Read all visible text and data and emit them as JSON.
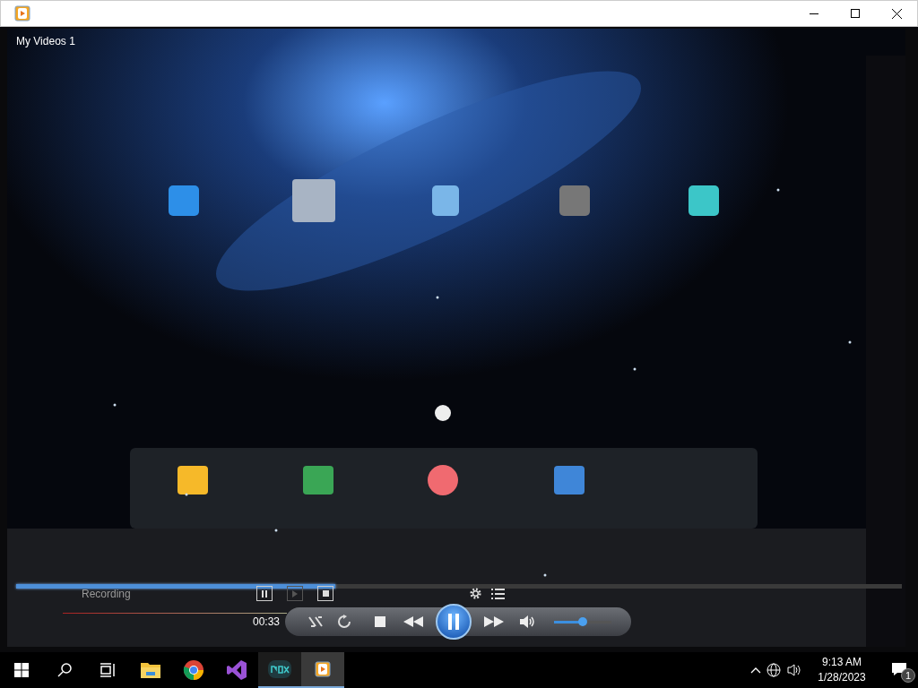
{
  "player": {
    "title": "My Videos 1",
    "recording_label": "Recording",
    "seek": {
      "level": 0.36
    },
    "elapsed": "00:33",
    "playing": true,
    "volume": {
      "level": 0.5
    }
  },
  "taskbar": {
    "apps": [
      {
        "kind": "explorer",
        "running": false,
        "selected": false
      },
      {
        "kind": "chrome",
        "running": false,
        "selected": false
      },
      {
        "kind": "studio",
        "running": false,
        "selected": false
      },
      {
        "kind": "nox",
        "running": true,
        "selected": false
      },
      {
        "kind": "player",
        "running": true,
        "selected": true
      }
    ],
    "time": "9:13 AM",
    "date": "1/28/2023",
    "notifications": "1"
  }
}
